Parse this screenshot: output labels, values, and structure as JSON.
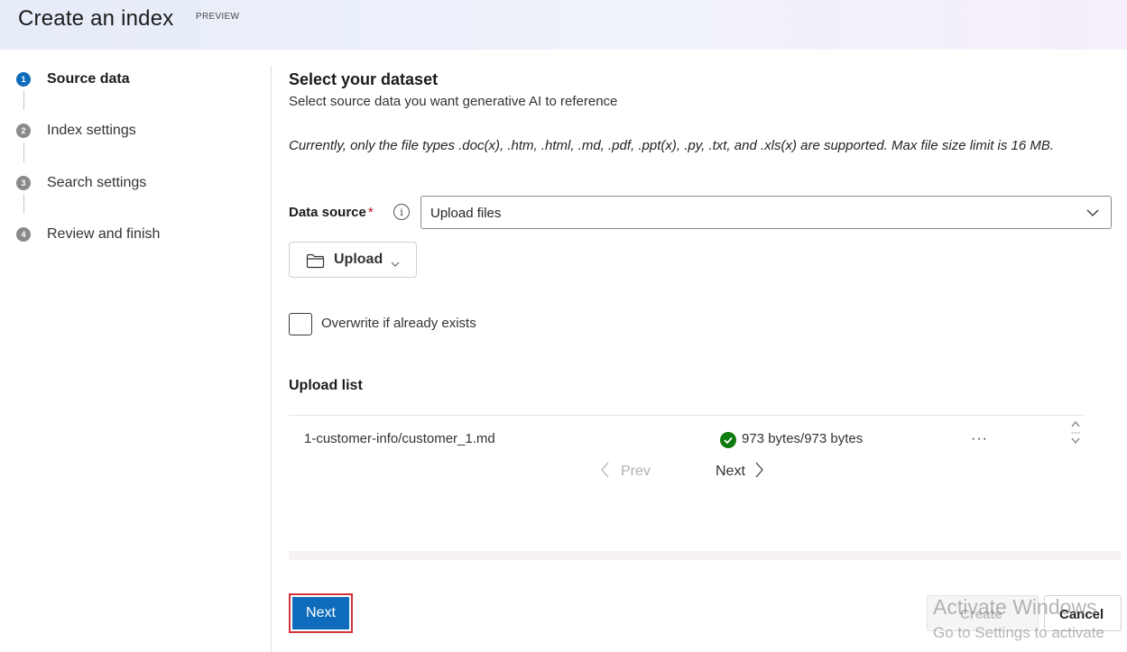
{
  "header": {
    "title": "Create an index",
    "badge": "PREVIEW"
  },
  "steps": [
    {
      "number": "1",
      "label": "Source data",
      "active": true
    },
    {
      "number": "2",
      "label": "Index settings",
      "active": false
    },
    {
      "number": "3",
      "label": "Search settings",
      "active": false
    },
    {
      "number": "4",
      "label": "Review and finish",
      "active": false
    }
  ],
  "main": {
    "title": "Select your dataset",
    "subtitle": "Select source data you want generative AI to reference",
    "note": "Currently, only the file types .doc(x), .htm, .html, .md, .pdf, .ppt(x), .py, .txt, and .xls(x) are supported. Max file size limit is 16 MB.",
    "data_source": {
      "label": "Data source",
      "required_mark": "*",
      "info_icon": "i",
      "value": "Upload files"
    },
    "upload_button": "Upload",
    "overwrite": {
      "label": "Overwrite if already exists",
      "checked": false
    },
    "upload_list": {
      "title": "Upload list",
      "rows": [
        {
          "name": "1-customer-info/customer_1.md",
          "size": "973 bytes/973 bytes",
          "status": "success"
        }
      ],
      "more": "···",
      "prev_label": "Prev",
      "next_label": "Next"
    }
  },
  "footer": {
    "next_label": "Next",
    "create_label": "Create",
    "cancel_label": "Cancel"
  },
  "watermark": {
    "line1": "Activate Windows",
    "line2": "Go to Settings to activate"
  },
  "colors": {
    "primary": "#0f6cbd",
    "highlight_border": "#d13438",
    "success": "#107c10",
    "required": "#c50f1f"
  }
}
